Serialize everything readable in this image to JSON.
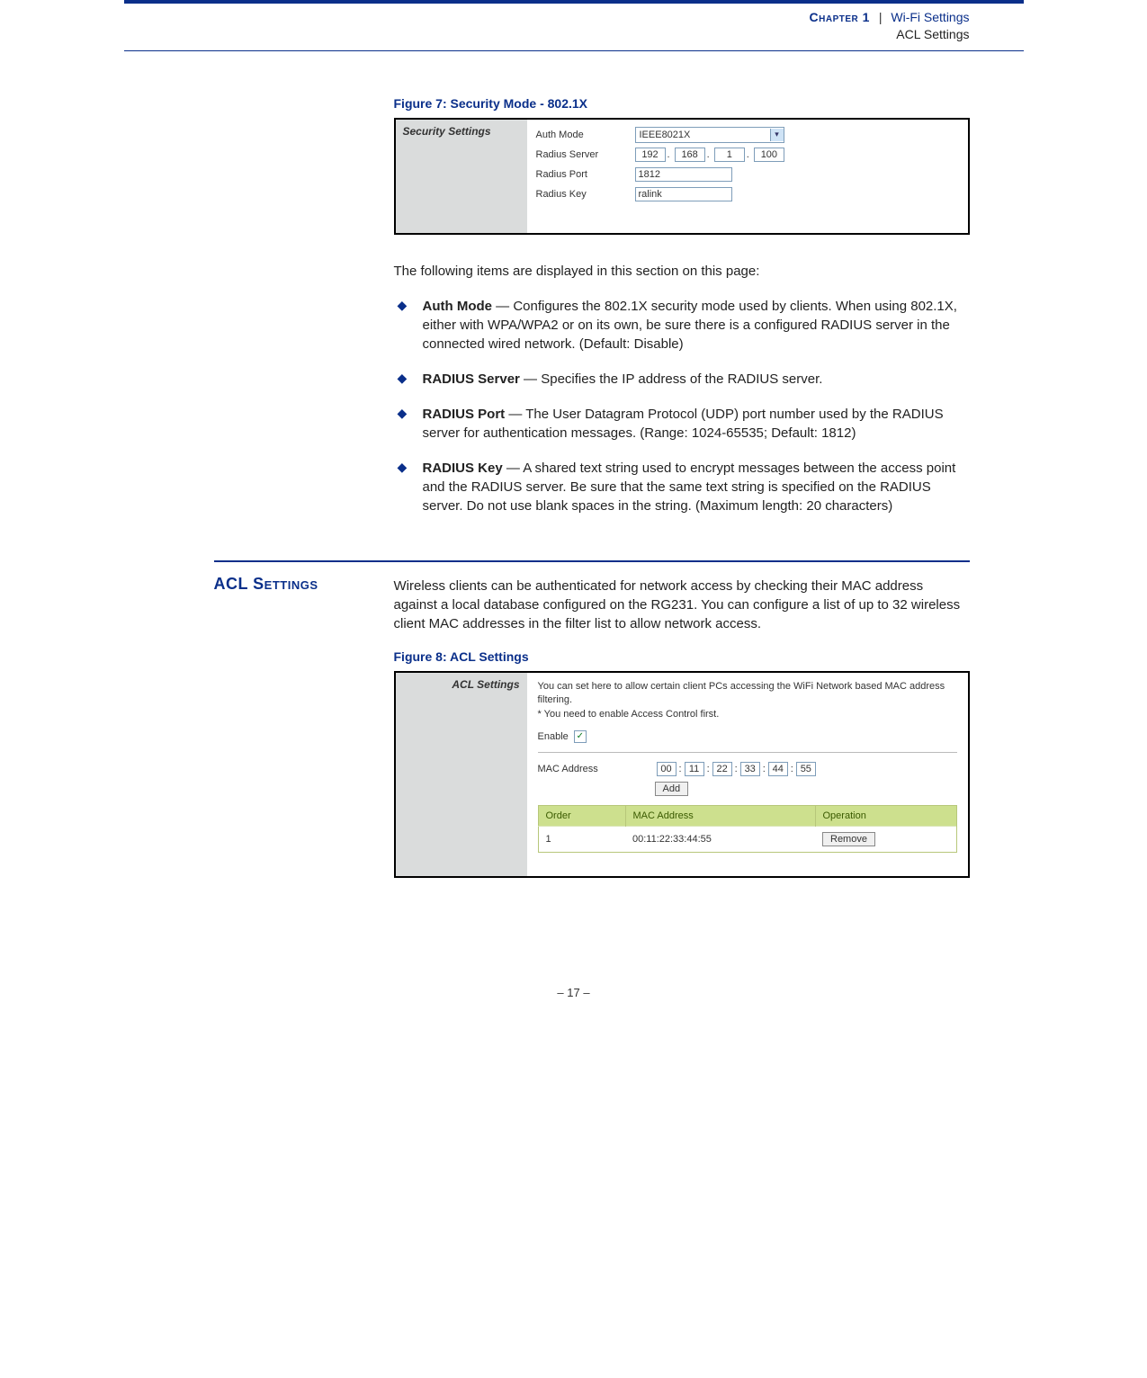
{
  "header": {
    "chapter_label": "Chapter 1",
    "section": "Wi-Fi Settings",
    "subsection": "ACL Settings"
  },
  "figure7": {
    "caption": "Figure 7:  Security Mode - 802.1X",
    "panel_title": "Security Settings",
    "fields": {
      "auth_mode_label": "Auth Mode",
      "auth_mode_value": "IEEE8021X",
      "radius_server_label": "Radius Server",
      "radius_ip": [
        "192",
        "168",
        "1",
        "100"
      ],
      "radius_port_label": "Radius Port",
      "radius_port_value": "1812",
      "radius_key_label": "Radius Key",
      "radius_key_value": "ralink"
    }
  },
  "intro_text": "The following items are displayed in this section on this page:",
  "bullets": {
    "auth_mode_term": "Auth Mode",
    "auth_mode_desc": " — Configures the 802.1X security mode used by clients. When using 802.1X, either with WPA/WPA2 or on its own, be sure there is a configured RADIUS server in the connected wired network. (Default: Disable)",
    "radius_server_term": "RADIUS Server",
    "radius_server_desc": " — Specifies the IP address of the RADIUS server.",
    "radius_port_term": "RADIUS Port",
    "radius_port_desc": " — The User Datagram Protocol (UDP) port number used by the RADIUS server for authentication messages. (Range: 1024-65535;  Default: 1812)",
    "radius_key_term": "RADIUS Key",
    "radius_key_desc": " — A shared text string used to encrypt messages between the access point and the RADIUS server. Be sure that the same text string is specified on the RADIUS server. Do not use blank spaces in the string. (Maximum length: 20 characters)"
  },
  "acl_section": {
    "heading": "ACL Settings",
    "intro": "Wireless clients can be authenticated for network access by checking their MAC address against a local database configured on the RG231. You can configure a list of up to 32 wireless client MAC addresses in the filter list to allow network access."
  },
  "figure8": {
    "caption": "Figure 8:  ACL Settings",
    "panel_title": "ACL Settings",
    "note_line1": "You can set here to allow certain client PCs accessing the WiFi Network based MAC address filtering.",
    "note_line2": "* You need to enable Access Control first.",
    "enable_label": "Enable",
    "enable_checked": "✓",
    "mac_label": "MAC Address",
    "mac": [
      "00",
      "11",
      "22",
      "33",
      "44",
      "55"
    ],
    "add_btn": "Add",
    "table": {
      "headers": {
        "order": "Order",
        "mac": "MAC Address",
        "op": "Operation"
      },
      "row": {
        "order": "1",
        "mac": "00:11:22:33:44:55",
        "remove": "Remove"
      }
    }
  },
  "footer": "–  17  –"
}
